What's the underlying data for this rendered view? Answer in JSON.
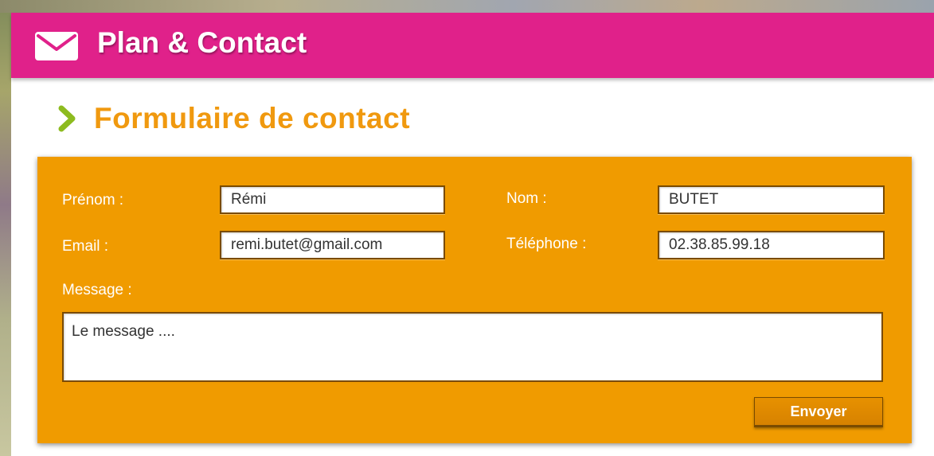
{
  "header": {
    "title": "Plan & Contact",
    "icon": "mail-icon"
  },
  "section": {
    "title": "Formulaire de contact",
    "icon": "chevron-right-icon"
  },
  "form": {
    "prenom": {
      "label": "Prénom :",
      "value": "Rémi"
    },
    "nom": {
      "label": "Nom :",
      "value": "BUTET"
    },
    "email": {
      "label": "Email :",
      "value": "remi.butet@gmail.com"
    },
    "telephone": {
      "label": "Téléphone :",
      "value": "02.38.85.99.18"
    },
    "message": {
      "label": "Message :",
      "value": "Le message ...."
    },
    "submit_label": "Envoyer"
  },
  "colors": {
    "header_bg": "#e0218a",
    "title_orange": "#f0990f",
    "panel_bg": "#f09b00",
    "chevron_green": "#8dbb1f"
  }
}
